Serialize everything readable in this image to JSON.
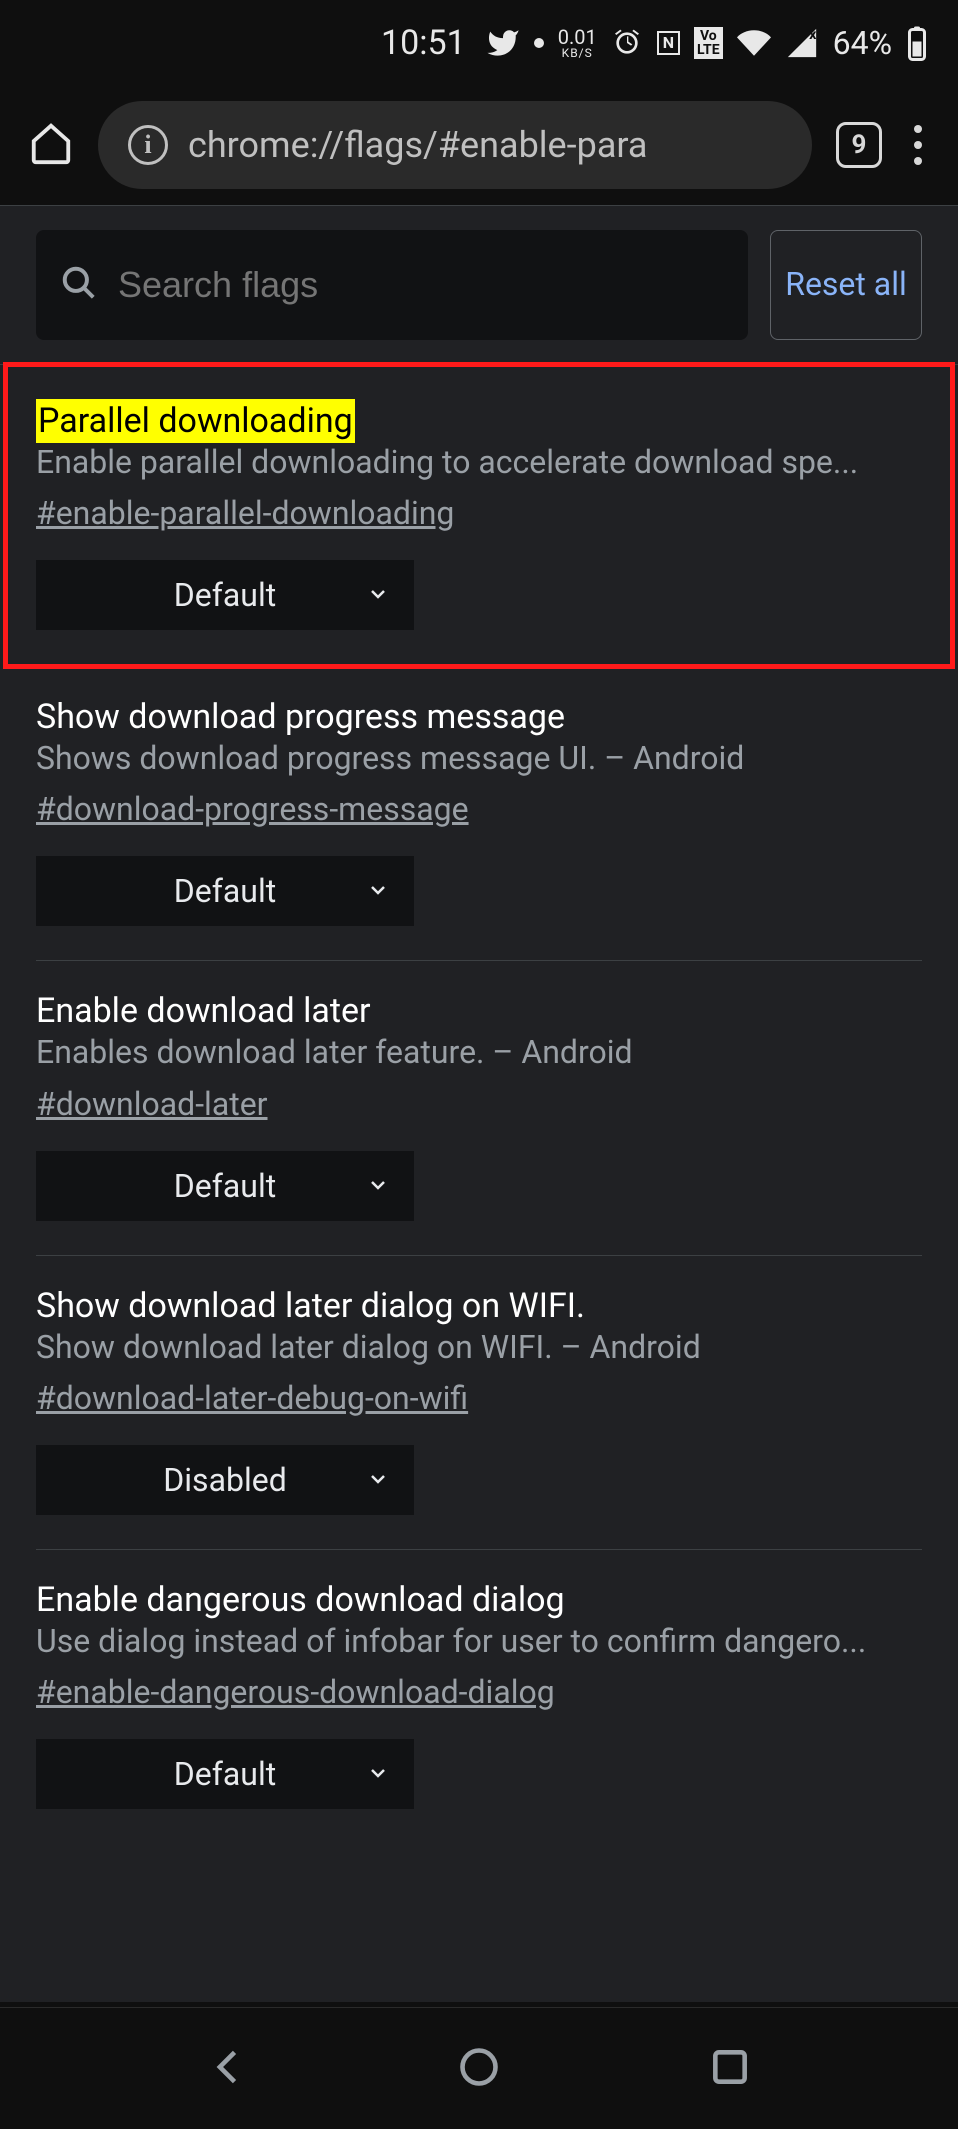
{
  "status": {
    "time": "10:51",
    "net_speed_top": "0.01",
    "net_speed_unit": "KB/S",
    "nfc_label": "N",
    "volte_label": "Voᴴ\nLTE",
    "battery_pct": "64%"
  },
  "toolbar": {
    "url": "chrome://flags/#enable-para",
    "tab_count": "9",
    "info_glyph": "i"
  },
  "search": {
    "placeholder": "Search flags",
    "reset_label": "Reset all"
  },
  "flags": [
    {
      "title": "Parallel downloading",
      "highlight_title": true,
      "desc": "Enable parallel downloading to accelerate download spe...",
      "hash": "#enable-parallel-downloading",
      "value": "Default"
    },
    {
      "title": "Show download progress message",
      "desc": "Shows download progress message UI. – Android",
      "hash": "#download-progress-message",
      "value": "Default"
    },
    {
      "title": "Enable download later",
      "desc": "Enables download later feature. – Android",
      "hash": "#download-later",
      "value": "Default"
    },
    {
      "title": "Show download later dialog on WIFI.",
      "desc": "Show download later dialog on WIFI. – Android",
      "hash": "#download-later-debug-on-wifi",
      "value": "Disabled"
    },
    {
      "title": "Enable dangerous download dialog",
      "desc": "Use dialog instead of infobar for user to confirm dangero...",
      "hash": "#enable-dangerous-download-dialog",
      "value": "Default"
    }
  ]
}
